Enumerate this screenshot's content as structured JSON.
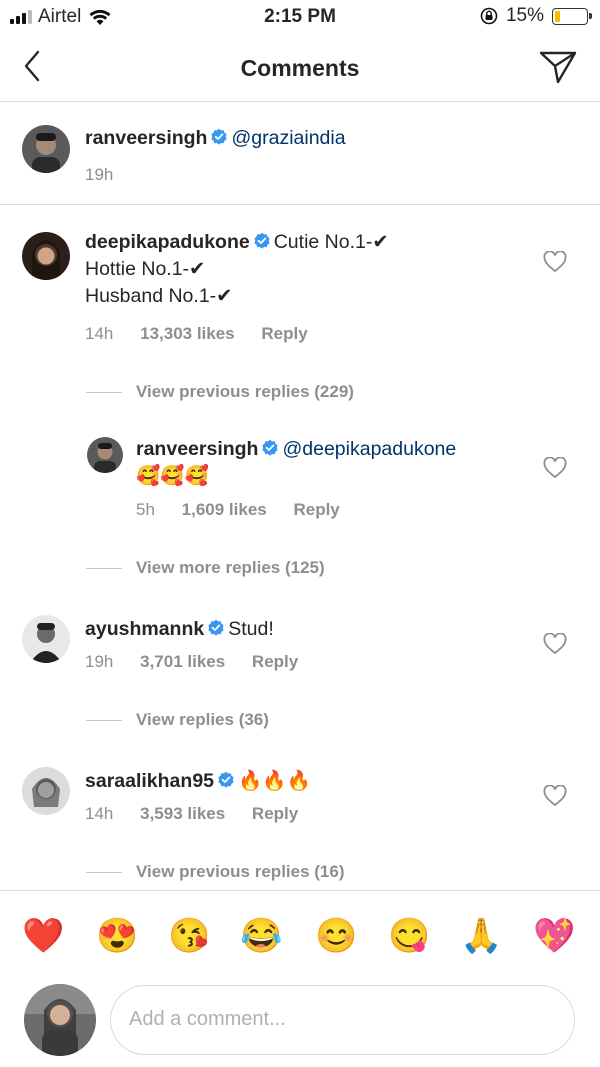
{
  "status_bar": {
    "carrier": "Airtel",
    "time": "2:15 PM",
    "battery": "15%",
    "battery_level": 0.15,
    "battery_color": "#f2c200"
  },
  "nav": {
    "title": "Comments",
    "back_icon": "chevron-left-icon",
    "send_icon": "paper-plane-icon"
  },
  "caption": {
    "username": "ranveersingh",
    "text": "@graziaindia",
    "time": "19h"
  },
  "comments": [
    {
      "username": "deepikapadukone",
      "line1": "Cutie No.1-✔",
      "line2": "Hottie No.1-✔",
      "line3": "Husband No.1-✔",
      "time": "14h",
      "likes": "13,303 likes",
      "reply": "Reply"
    },
    {
      "view": "View previous replies (229)"
    },
    {
      "username": "ranveersingh",
      "text": "@deepikapadukone",
      "emojis": "🥰🥰🥰",
      "time": "5h",
      "likes": "1,609 likes",
      "reply": "Reply"
    },
    {
      "view": "View more replies (125)"
    },
    {
      "username": "ayushmannk",
      "text": "Stud!",
      "time": "19h",
      "likes": "3,701 likes",
      "reply": "Reply"
    },
    {
      "view": "View replies (36)"
    },
    {
      "username": "saraalikhan95",
      "text": "🔥🔥🔥",
      "time": "14h",
      "likes": "3,593 likes",
      "reply": "Reply"
    },
    {
      "view": "View previous replies (16)"
    }
  ],
  "emoji_bar": [
    "❤️",
    "😍",
    "😘",
    "😂",
    "😊",
    "😋",
    "🙏",
    "💖"
  ],
  "composer": {
    "placeholder": "Add a comment..."
  },
  "colors": {
    "verified": "#3897f0",
    "mention": "#003569",
    "muted": "#8e8e8e",
    "divider": "#dbdbdb"
  }
}
